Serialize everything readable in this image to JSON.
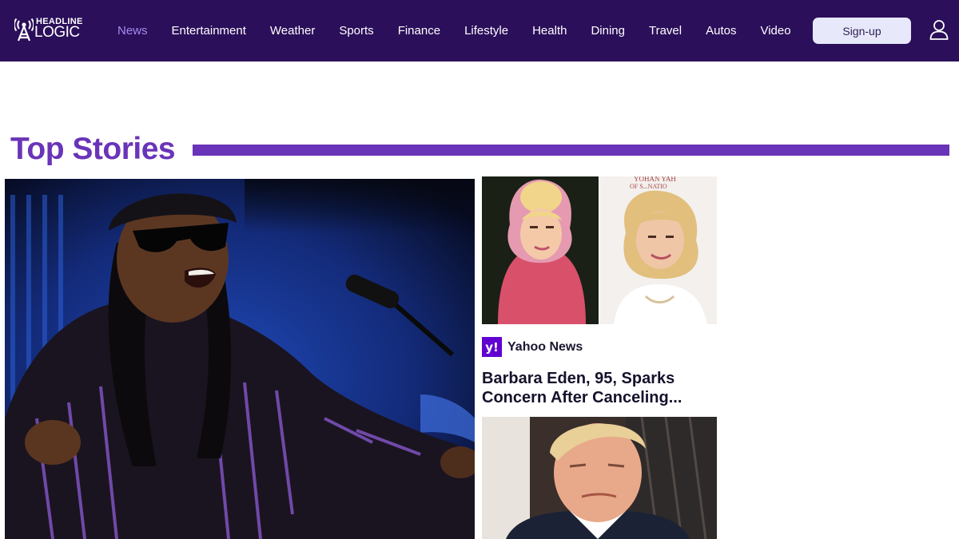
{
  "brand": {
    "line1": "HEADLINE",
    "line2": "LOGIC"
  },
  "nav": {
    "items": [
      {
        "label": "News",
        "active": true
      },
      {
        "label": "Entertainment"
      },
      {
        "label": "Weather"
      },
      {
        "label": "Sports"
      },
      {
        "label": "Finance"
      },
      {
        "label": "Lifestyle"
      },
      {
        "label": "Health"
      },
      {
        "label": "Dining"
      },
      {
        "label": "Travel"
      },
      {
        "label": "Autos"
      },
      {
        "label": "Video"
      }
    ],
    "signup_label": "Sign-up",
    "user_icon": "user-icon"
  },
  "section": {
    "title": "Top Stories"
  },
  "stories": {
    "side1": {
      "source_logo": "y!",
      "source": "Yahoo News",
      "headline": "Barbara Eden, 95, Sparks Concern After Canceling..."
    }
  },
  "colors": {
    "nav_bg": "#2b0f5a",
    "accent": "#6a34b8",
    "active_nav": "#a58bf0",
    "signup_bg": "#e7e8fa",
    "source_brand": "#6001d2"
  }
}
